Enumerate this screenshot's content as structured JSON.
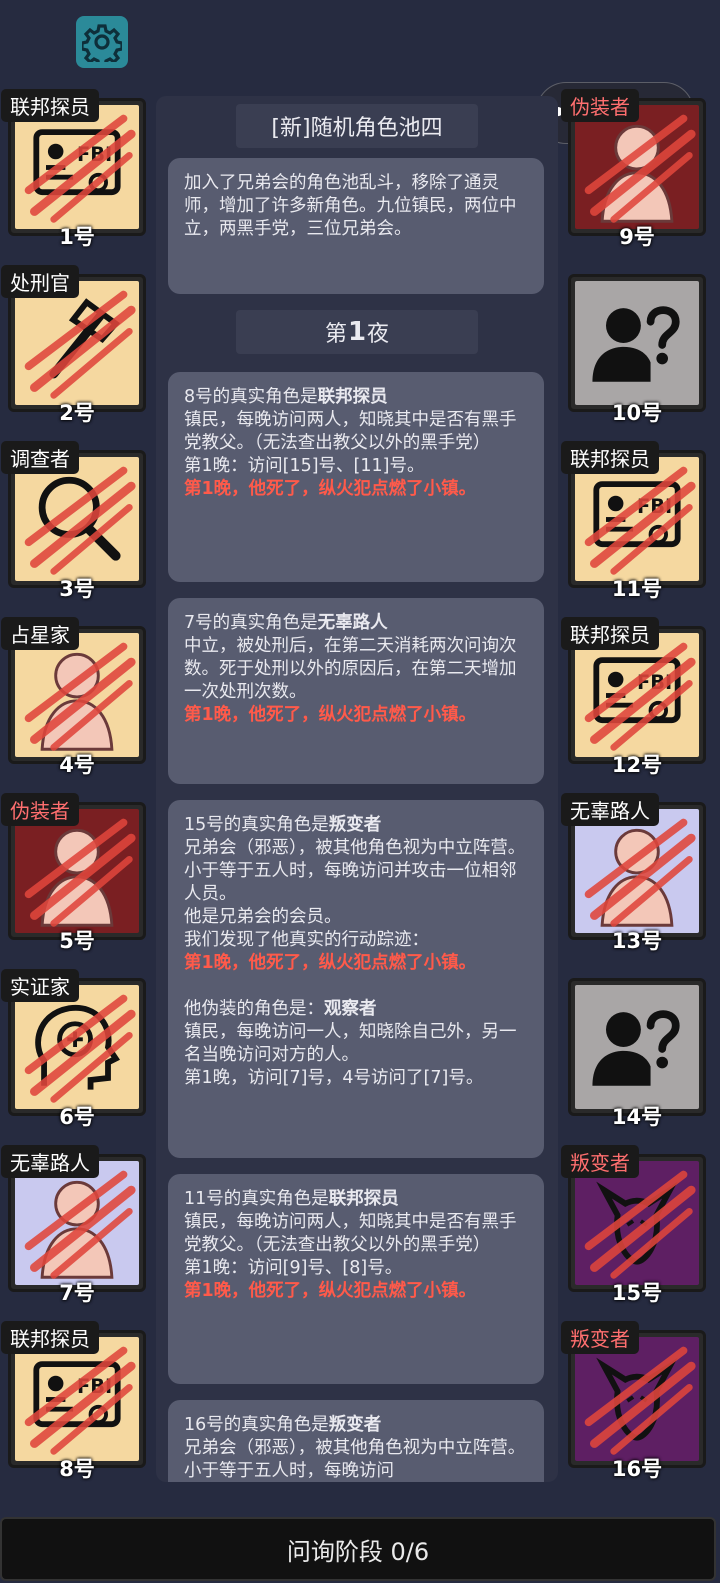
{
  "settings_icon": "gear-icon",
  "capsule": {
    "menu_icon": "more-dots-icon",
    "close_icon": "target-circle-icon"
  },
  "left_players": [
    {
      "role": "联邦探员",
      "role_color": "white",
      "num": "1号",
      "art": "fbi",
      "bg": "#f5d8a0"
    },
    {
      "role": "处刑官",
      "role_color": "white",
      "num": "2号",
      "art": "axe",
      "bg": "#f5d8a0"
    },
    {
      "role": "调查者",
      "role_color": "white",
      "num": "3号",
      "art": "magnifier",
      "bg": "#f5d8a0"
    },
    {
      "role": "占星家",
      "role_color": "white",
      "num": "4号",
      "art": "person",
      "bg": "#f5d8a0"
    },
    {
      "role": "伪装者",
      "role_color": "red",
      "num": "5号",
      "art": "person",
      "bg": "#7a1f22"
    },
    {
      "role": "实证家",
      "role_color": "white",
      "num": "6号",
      "art": "head",
      "bg": "#f5d8a0"
    },
    {
      "role": "无辜路人",
      "role_color": "white",
      "num": "7号",
      "art": "person",
      "bg": "#c9c9ef"
    },
    {
      "role": "联邦探员",
      "role_color": "white",
      "num": "8号",
      "art": "fbi",
      "bg": "#f5d8a0"
    }
  ],
  "right_players": [
    {
      "role": "伪装者",
      "role_color": "red",
      "num": "9号",
      "art": "person",
      "bg": "#7a1f22"
    },
    {
      "role": "",
      "role_color": "white",
      "num": "10号",
      "art": "unknown",
      "bg": "#a9a6a6"
    },
    {
      "role": "联邦探员",
      "role_color": "white",
      "num": "11号",
      "art": "fbi",
      "bg": "#f5d8a0"
    },
    {
      "role": "联邦探员",
      "role_color": "white",
      "num": "12号",
      "art": "fbi",
      "bg": "#f5d8a0"
    },
    {
      "role": "无辜路人",
      "role_color": "white",
      "num": "13号",
      "art": "person",
      "bg": "#c9c9ef"
    },
    {
      "role": "",
      "role_color": "white",
      "num": "14号",
      "art": "unknown",
      "bg": "#a9a6a6"
    },
    {
      "role": "叛变者",
      "role_color": "red",
      "num": "15号",
      "art": "cat",
      "bg": "#5e1f63"
    },
    {
      "role": "叛变者",
      "role_color": "red",
      "num": "16号",
      "art": "cat",
      "bg": "#5e1f63"
    }
  ],
  "log": {
    "pool_title": "[新]随机角色池四",
    "pool_desc": "加入了兄弟会的角色池乱斗，移除了通灵师，增加了许多新角色。九位镇民，两位中立，两黑手党，三位兄弟会。",
    "night_prefix": "第",
    "night_num": "1",
    "night_suffix": "夜",
    "cards": [
      {
        "intro": "8号的真实角色是",
        "role": "联邦探员",
        "desc": "镇民，每晚访问两人，知晓其中是否有黑手党教父。（无法查出教父以外的黑手党）",
        "visit": "第1晚：访问[15]号、[11]号。",
        "death": "第1晚，他死了，纵火犯点燃了小镇。"
      },
      {
        "intro": "7号的真实角色是",
        "role": "无辜路人",
        "desc": "中立，被处刑后，在第二天消耗两次问询次数。死于处刑以外的原因后，在第二天增加一次处刑次数。",
        "death": "第1晚，他死了，纵火犯点燃了小镇。"
      },
      {
        "intro": "15号的真实角色是",
        "role": "叛变者",
        "desc": "兄弟会（邪恶），被其他角色视为中立阵营。小于等于五人时，每晚访问并攻击一位相邻人员。",
        "extra1": "他是兄弟会的会员。",
        "extra2": "我们发现了他真实的行动踪迹：",
        "death": "第1晚，他死了，纵火犯点燃了小镇。",
        "disguise_intro": "他伪装的角色是：",
        "disguise_role": "观察者",
        "disguise_desc": "镇民，每晚访问一人，知晓除自己外，另一名当晚访问对方的人。",
        "disguise_visit": "第1晚，访问[7]号，4号访问了[7]号。"
      },
      {
        "intro": "11号的真实角色是",
        "role": "联邦探员",
        "desc": "镇民，每晚访问两人，知晓其中是否有黑手党教父。（无法查出教父以外的黑手党）",
        "visit": "第1晚：访问[9]号、[8]号。",
        "death": "第1晚，他死了，纵火犯点燃了小镇。"
      },
      {
        "intro": "16号的真实角色是",
        "role": "叛变者",
        "desc": "兄弟会（邪恶），被其他角色视为中立阵营。小于等于五人时，每晚访问"
      }
    ]
  },
  "bottom_bar": "问询阶段 0/6"
}
